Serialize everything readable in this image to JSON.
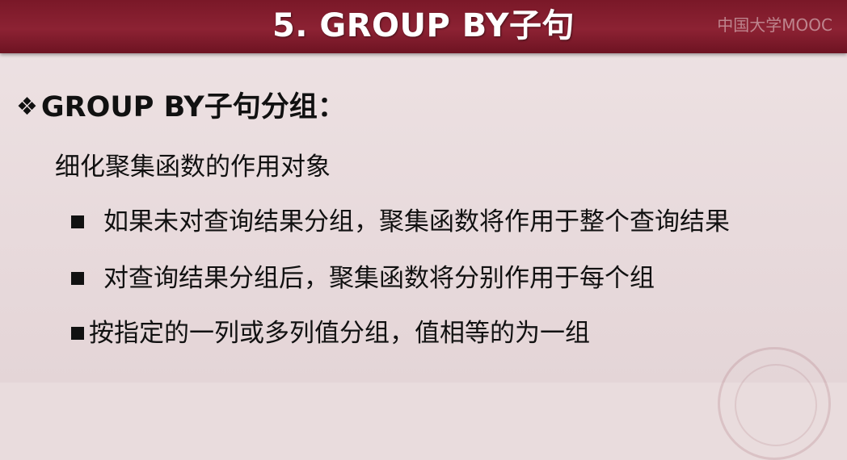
{
  "slide": {
    "title": "5. GROUP BY子句",
    "watermark": "中国大学MOOC",
    "heading": {
      "icon": "diamond-bullet-icon",
      "text": "GROUP BY子句分组："
    },
    "subtitle": "细化聚集函数的作用对象",
    "bullets": [
      {
        "icon": "square-bullet-icon",
        "text": "如果未对查询结果分组，聚集函数将作用于整个查询结果"
      },
      {
        "icon": "square-bullet-icon",
        "text": "对查询结果分组后，聚集函数将分别作用于每个组"
      },
      {
        "icon": "square-bullet-icon",
        "text": "按指定的一列或多列值分组，值相等的为一组"
      }
    ]
  },
  "colors": {
    "title_bar": "#8c2233",
    "background": "#e9dcdd",
    "title_text": "#ffffff",
    "body_text": "#111111"
  }
}
